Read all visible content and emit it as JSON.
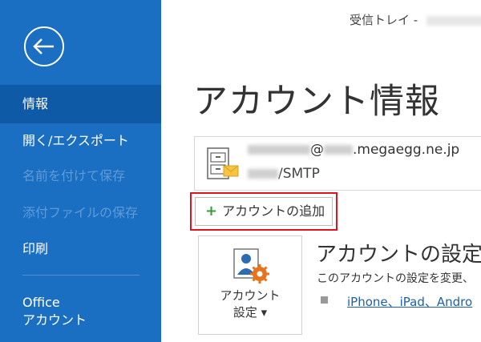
{
  "window": {
    "title": "受信トレイ -"
  },
  "sidebar": {
    "items": [
      {
        "label": "情報"
      },
      {
        "label": "開く/エクスポート"
      },
      {
        "label": "名前を付けて保存"
      },
      {
        "label": "添付ファイルの保存"
      },
      {
        "label": "印刷"
      }
    ],
    "office_account": {
      "line1": "Office",
      "line2": "アカウント"
    }
  },
  "main": {
    "page_title": "アカウント情報",
    "account": {
      "email_domain": "@",
      "email_suffix": ".megaegg.ne.jp",
      "protocol_suffix": "/SMTP"
    },
    "add_account_label": "アカウントの追加",
    "settings_tile": {
      "line1": "アカウント",
      "line2": "設定 ▾"
    },
    "settings_heading": "アカウントの設定",
    "settings_description": "このアカウントの設定を変更、",
    "device_link": "iPhone、iPad、Andro"
  }
}
